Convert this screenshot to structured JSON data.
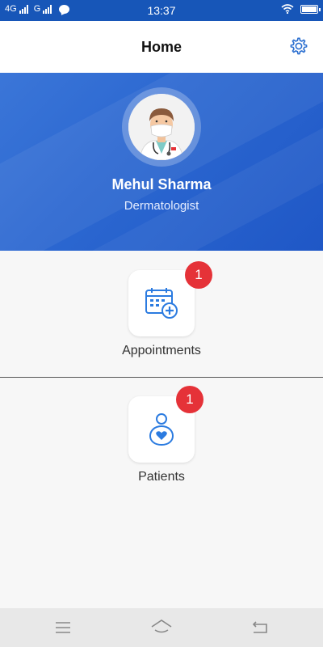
{
  "status_bar": {
    "network_1": "4G",
    "network_2": "G",
    "time": "13:37",
    "icons": [
      "signal-icon",
      "message-icon",
      "wifi-icon",
      "battery-icon"
    ]
  },
  "header": {
    "title": "Home",
    "settings_icon": "gear-icon"
  },
  "profile": {
    "name": "Mehul Sharma",
    "role": "Dermatologist",
    "avatar_icon": "doctor-avatar-icon"
  },
  "menu": {
    "items": [
      {
        "label": "Appointments",
        "badge": "1",
        "icon": "calendar-plus-icon"
      },
      {
        "label": "Patients",
        "badge": "1",
        "icon": "patient-heart-icon"
      }
    ]
  },
  "nav_bar": {
    "icons": [
      "menu-icon",
      "home-icon",
      "back-icon"
    ]
  },
  "colors": {
    "primary": "#1756b8",
    "badge": "#e53238",
    "icon_blue": "#2b7be0"
  }
}
